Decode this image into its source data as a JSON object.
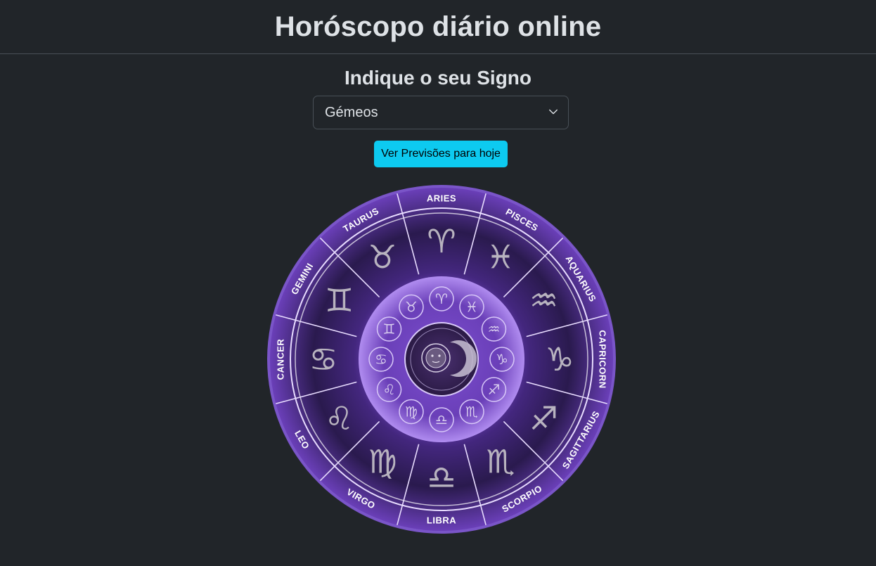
{
  "header": {
    "title": "Horóscopo diário online"
  },
  "form": {
    "subtitle": "Indique o seu Signo",
    "select_value": "Gémeos",
    "button_label": "Ver Previsões para hoje"
  },
  "wheel": {
    "signs": [
      {
        "label": "ARIES",
        "glyph": "♈"
      },
      {
        "label": "PISCES",
        "glyph": "♓"
      },
      {
        "label": "AQUARIUS",
        "glyph": "♒"
      },
      {
        "label": "CAPRICORN",
        "glyph": "♑"
      },
      {
        "label": "SAGITTARIUS",
        "glyph": "♐"
      },
      {
        "label": "SCORPIO",
        "glyph": "♏"
      },
      {
        "label": "LIBRA",
        "glyph": "♎"
      },
      {
        "label": "VIRGO",
        "glyph": "♍"
      },
      {
        "label": "LEO",
        "glyph": "♌"
      },
      {
        "label": "CANCER",
        "glyph": "♋"
      },
      {
        "label": "GEMINI",
        "glyph": "♊"
      },
      {
        "label": "TAURUS",
        "glyph": "♉"
      }
    ],
    "colors": {
      "outer": "#4a2a8a",
      "ring": "#2a1a4e",
      "glow": "#9b6ee8",
      "inner": "#6a3fb8",
      "center": "#3a2266"
    }
  }
}
